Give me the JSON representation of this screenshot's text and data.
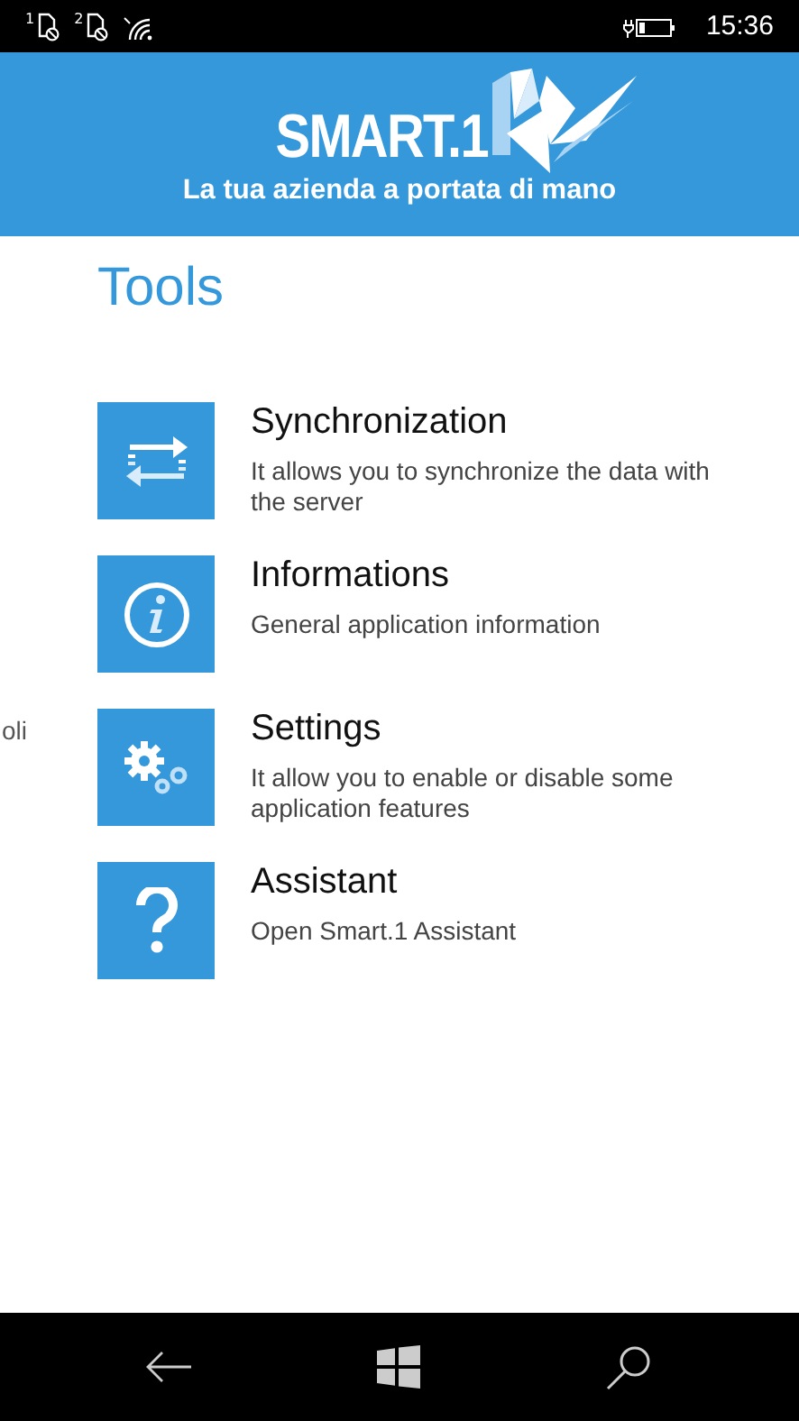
{
  "status_bar": {
    "sims": [
      "1",
      "2"
    ],
    "time": "15:36"
  },
  "header": {
    "logo": "SMART.1",
    "tagline": "La tua azienda a portata di mano"
  },
  "page_title": "Tools",
  "side_text": "oli",
  "items": [
    {
      "kind": "sync",
      "title": "Synchronization",
      "description": "It allows you to synchronize the data with the server"
    },
    {
      "kind": "info",
      "title": "Informations",
      "description": "General application information"
    },
    {
      "kind": "settings",
      "title": "Settings",
      "description": "It allow you to enable or disable some application features"
    },
    {
      "kind": "help",
      "title": "Assistant",
      "description": "Open Smart.1 Assistant"
    }
  ]
}
